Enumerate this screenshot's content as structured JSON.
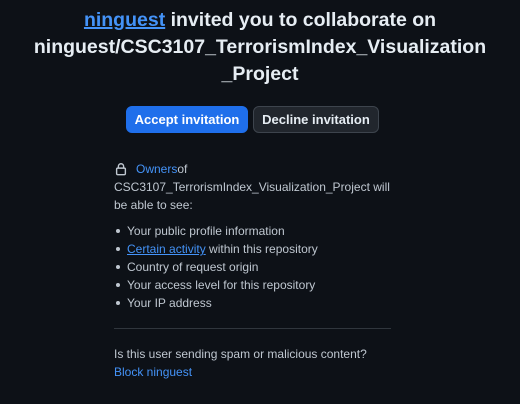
{
  "invite": {
    "inviter": "ninguest",
    "message": " invited you to collaborate on",
    "repo": "ninguest/CSC3107_TerrorismIndex_Visualization_Project"
  },
  "actions": {
    "accept_label": "Accept invitation",
    "decline_label": "Decline invitation"
  },
  "visibility": {
    "lock_icon": "lock-icon",
    "owners_label": "Owners",
    "of_text": " of",
    "repo_line": "CSC3107_TerrorismIndex_Visualization_Project will",
    "able_text": "be able to see:",
    "items": [
      {
        "text": "Your public profile information"
      },
      {
        "link": "Certain activity",
        "text": " within this repository"
      },
      {
        "text": "Country of request origin"
      },
      {
        "text": "Your access level for this repository"
      },
      {
        "text": "Your IP address"
      }
    ]
  },
  "spam": {
    "question": "Is this user sending spam or malicious content?",
    "block_label": "Block ninguest"
  },
  "colors": {
    "background": "#0d1117",
    "accent": "#1f6feb",
    "link": "#4493f8"
  }
}
